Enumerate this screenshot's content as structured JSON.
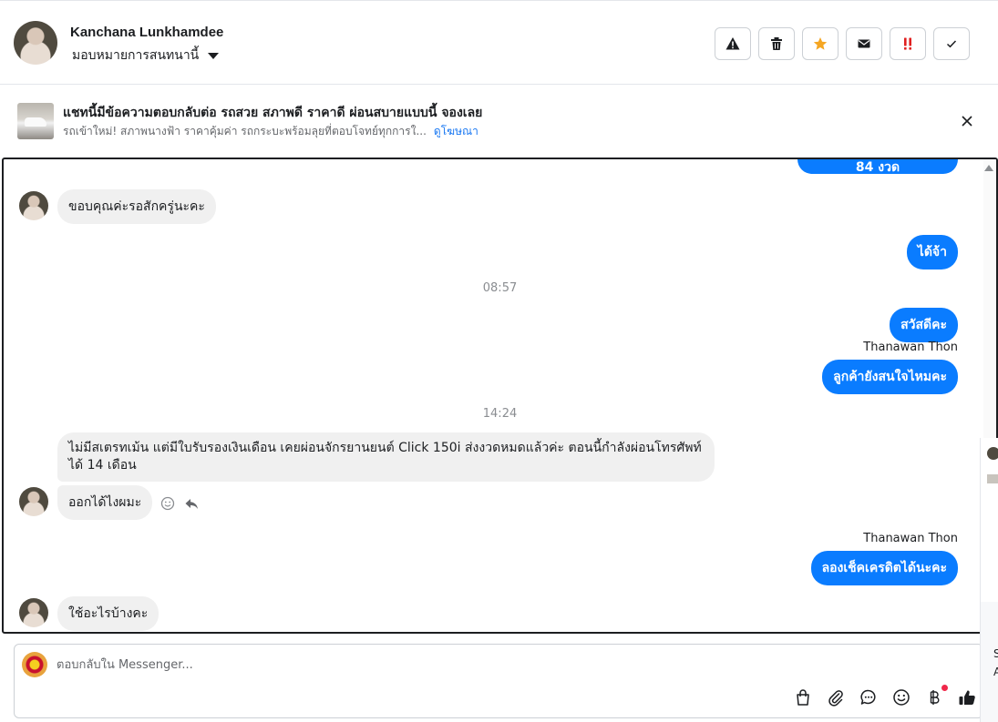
{
  "header": {
    "contact_name": "Kanchana Lunkhamdee",
    "assign_label": "มอบหมายการสนทนานี้",
    "actions": [
      {
        "name": "report-spam",
        "icon": "warning-icon"
      },
      {
        "name": "delete",
        "icon": "trash-icon"
      },
      {
        "name": "star",
        "icon": "star-icon",
        "color": "#f5a623"
      },
      {
        "name": "mark-unread",
        "icon": "envelope-icon"
      },
      {
        "name": "important",
        "icon": "double-exclamation-icon",
        "color": "#e02020"
      },
      {
        "name": "done",
        "icon": "checkmark-icon"
      }
    ]
  },
  "ad": {
    "title": "แชทนี้มีข้อความตอบกลับต่อ รถสวย สภาพดี ราคาดี ผ่อนสบายแบบนี้ จองเลย",
    "subtitle": "รถเข้าใหม่! สภาพนางฟ้า ราคาคุ้มค่า รถกระบะพร้อมลุยที่ตอบโจทย์ทุกการใ...",
    "link": "ดูโฆษณา"
  },
  "messages": {
    "top_partial": "84 งวด",
    "m1_in": "ขอบคุณค่ะรอสักครู่นะคะ",
    "m2_out": "ได้จ้า",
    "time1": "08:57",
    "m3_out": "สวัสดีคะ",
    "sender1": "Thanawan Thon",
    "m4_out": "ลูกค้ายังสนใจไหมคะ",
    "time2": "14:24",
    "m5_in": "ไม่มีสเตรทเม้น แต่มีใบรับรองเงินเดือน เคยผ่อนจักรยานยนต์ Click 150i ส่งงวดหมดแล้วค่ะ ตอนนี้กำลังผ่อนโทรศัพท์ได้ 14 เดือน",
    "m6_in": "ออกได้ไงผมะ",
    "sender2": "Thanawan Thon",
    "m7_out": "ลองเช็คเครดิตได้นะคะ",
    "m8_in": "ใช้อะไรบ้างคะ"
  },
  "composer": {
    "placeholder": "ตอบกลับใน Messenger...",
    "tools": [
      "shopping-bag-icon",
      "paperclip-icon",
      "chat-bubble-icon",
      "emoji-icon",
      "baht-icon",
      "thumbs-up-icon"
    ]
  },
  "side_panel": {
    "letter_1": "S",
    "letter_2": "A"
  }
}
